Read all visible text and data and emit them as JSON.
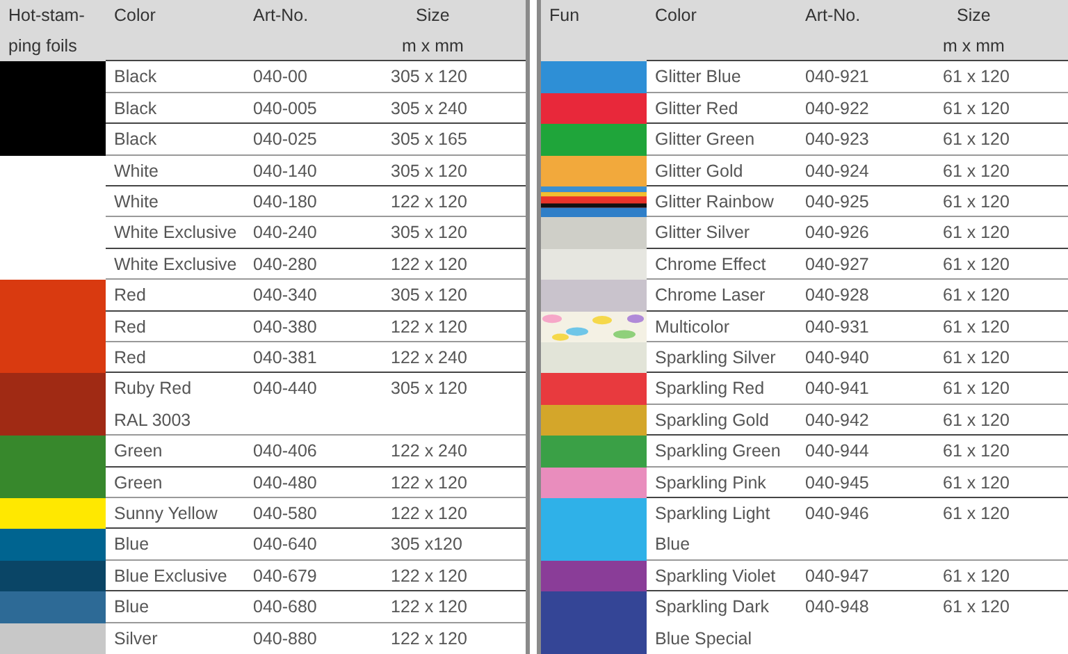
{
  "tables": [
    {
      "columns": [
        "Hot-stam-\nping foils",
        "Color",
        "Art-No.",
        "Size\nm x mm"
      ],
      "rows": [
        {
          "swatch": {
            "kind": "solid",
            "color": "#000000"
          },
          "color_name": "Black",
          "art_no": "040-00",
          "size": "305 x 120"
        },
        {
          "swatch": {
            "kind": "solid",
            "color": "#000000"
          },
          "color_name": "Black",
          "art_no": "040-005",
          "size": "305 x 240"
        },
        {
          "swatch": {
            "kind": "solid",
            "color": "#000000"
          },
          "color_name": "Black",
          "art_no": "040-025",
          "size": "305 x 165"
        },
        {
          "swatch": {
            "kind": "solid",
            "color": "#ffffff"
          },
          "color_name": "White",
          "art_no": "040-140",
          "size": "305 x 120"
        },
        {
          "swatch": {
            "kind": "solid",
            "color": "#ffffff"
          },
          "color_name": "White",
          "art_no": "040-180",
          "size": "122 x 120"
        },
        {
          "swatch": {
            "kind": "solid",
            "color": "#ffffff"
          },
          "color_name": "White Exclusive",
          "art_no": "040-240",
          "size": "305 x 120"
        },
        {
          "swatch": {
            "kind": "solid",
            "color": "#ffffff"
          },
          "color_name": "White Exclusive",
          "art_no": "040-280",
          "size": "122 x 120"
        },
        {
          "swatch": {
            "kind": "solid",
            "color": "#d93a10"
          },
          "color_name": "Red",
          "art_no": "040-340",
          "size": "305 x 120"
        },
        {
          "swatch": {
            "kind": "solid",
            "color": "#d93a10"
          },
          "color_name": "Red",
          "art_no": "040-380",
          "size": "122 x 120"
        },
        {
          "swatch": {
            "kind": "solid",
            "color": "#d93a10"
          },
          "color_name": "Red",
          "art_no": "040-381",
          "size": "122 x 240"
        },
        {
          "swatch": {
            "kind": "solid",
            "color": "#a02a14"
          },
          "color_name": "Ruby Red\nRAL 3003",
          "art_no": "040-440",
          "size": "305 x 120"
        },
        {
          "swatch": {
            "kind": "solid",
            "color": "#37882c"
          },
          "color_name": "Green",
          "art_no": "040-406",
          "size": "122 x 240"
        },
        {
          "swatch": {
            "kind": "solid",
            "color": "#37882c"
          },
          "color_name": "Green",
          "art_no": "040-480",
          "size": "122 x 120"
        },
        {
          "swatch": {
            "kind": "solid",
            "color": "#ffe800"
          },
          "color_name": "Sunny Yellow",
          "art_no": "040-580",
          "size": "122 x 120"
        },
        {
          "swatch": {
            "kind": "solid",
            "color": "#006490"
          },
          "color_name": "Blue",
          "art_no": "040-640",
          "size": "305 x120"
        },
        {
          "swatch": {
            "kind": "solid",
            "color": "#0a4566"
          },
          "color_name": "Blue Exclusive",
          "art_no": "040-679",
          "size": "122 x 120"
        },
        {
          "swatch": {
            "kind": "solid",
            "color": "#2d6a96"
          },
          "color_name": "Blue",
          "art_no": "040-680",
          "size": "122 x 120"
        },
        {
          "swatch": {
            "kind": "solid",
            "color": "#c8c8c8"
          },
          "color_name": "Silver",
          "art_no": "040-880",
          "size": "122 x 120"
        }
      ]
    },
    {
      "columns": [
        "Fun",
        "Color",
        "Art-No.",
        "Size\nm x mm"
      ],
      "rows": [
        {
          "swatch": {
            "kind": "solid",
            "color": "#2e8fd6"
          },
          "color_name": "Glitter Blue",
          "art_no": "040-921",
          "size": "61 x 120"
        },
        {
          "swatch": {
            "kind": "solid",
            "color": "#e8283a"
          },
          "color_name": "Glitter Red",
          "art_no": "040-922",
          "size": "61 x 120"
        },
        {
          "swatch": {
            "kind": "solid",
            "color": "#1fa53a"
          },
          "color_name": "Glitter Green",
          "art_no": "040-923",
          "size": "61 x 120"
        },
        {
          "swatch": {
            "kind": "solid",
            "color": "#f2a93c"
          },
          "color_name": "Glitter Gold",
          "art_no": "040-924",
          "size": "61 x 120"
        },
        {
          "swatch": {
            "kind": "rainbow",
            "color": "#e8332a"
          },
          "color_name": "Glitter Rainbow",
          "art_no": "040-925",
          "size": "61 x 120"
        },
        {
          "swatch": {
            "kind": "solid",
            "color": "#cfcfc8"
          },
          "color_name": "Glitter Silver",
          "art_no": "040-926",
          "size": "61 x 120"
        },
        {
          "swatch": {
            "kind": "solid",
            "color": "#e6e6e0"
          },
          "color_name": "Chrome Effect",
          "art_no": "040-927",
          "size": "61 x 120"
        },
        {
          "swatch": {
            "kind": "solid",
            "color": "#c9c3cc"
          },
          "color_name": "Chrome Laser",
          "art_no": "040-928",
          "size": "61 x 120"
        },
        {
          "swatch": {
            "kind": "confetti",
            "color": "#f4f1e4"
          },
          "color_name": "Multicolor",
          "art_no": "040-931",
          "size": "61 x 120"
        },
        {
          "swatch": {
            "kind": "solid",
            "color": "#e2e4d8"
          },
          "color_name": "Sparkling Silver",
          "art_no": "040-940",
          "size": "61 x 120"
        },
        {
          "swatch": {
            "kind": "solid",
            "color": "#e83a3e"
          },
          "color_name": "Sparkling Red",
          "art_no": "040-941",
          "size": "61 x 120"
        },
        {
          "swatch": {
            "kind": "solid",
            "color": "#d4a62a"
          },
          "color_name": "Sparkling Gold",
          "art_no": "040-942",
          "size": "61 x 120"
        },
        {
          "swatch": {
            "kind": "solid",
            "color": "#3aa046"
          },
          "color_name": "Sparkling Green",
          "art_no": "040-944",
          "size": "61 x 120"
        },
        {
          "swatch": {
            "kind": "solid",
            "color": "#e98dbd"
          },
          "color_name": "Sparkling Pink",
          "art_no": "040-945",
          "size": "61 x 120"
        },
        {
          "swatch": {
            "kind": "solid",
            "color": "#2fb1e8"
          },
          "color_name": "Sparkling Light\nBlue",
          "art_no": "040-946",
          "size": "61 x 120"
        },
        {
          "swatch": {
            "kind": "solid",
            "color": "#8a3d98"
          },
          "color_name": "Sparkling Violet",
          "art_no": "040-947",
          "size": "61 x 120"
        },
        {
          "swatch": {
            "kind": "solid",
            "color": "#344596"
          },
          "color_name": "Sparkling Dark\nBlue Special",
          "art_no": "040-948",
          "size": "61 x 120"
        }
      ]
    }
  ]
}
